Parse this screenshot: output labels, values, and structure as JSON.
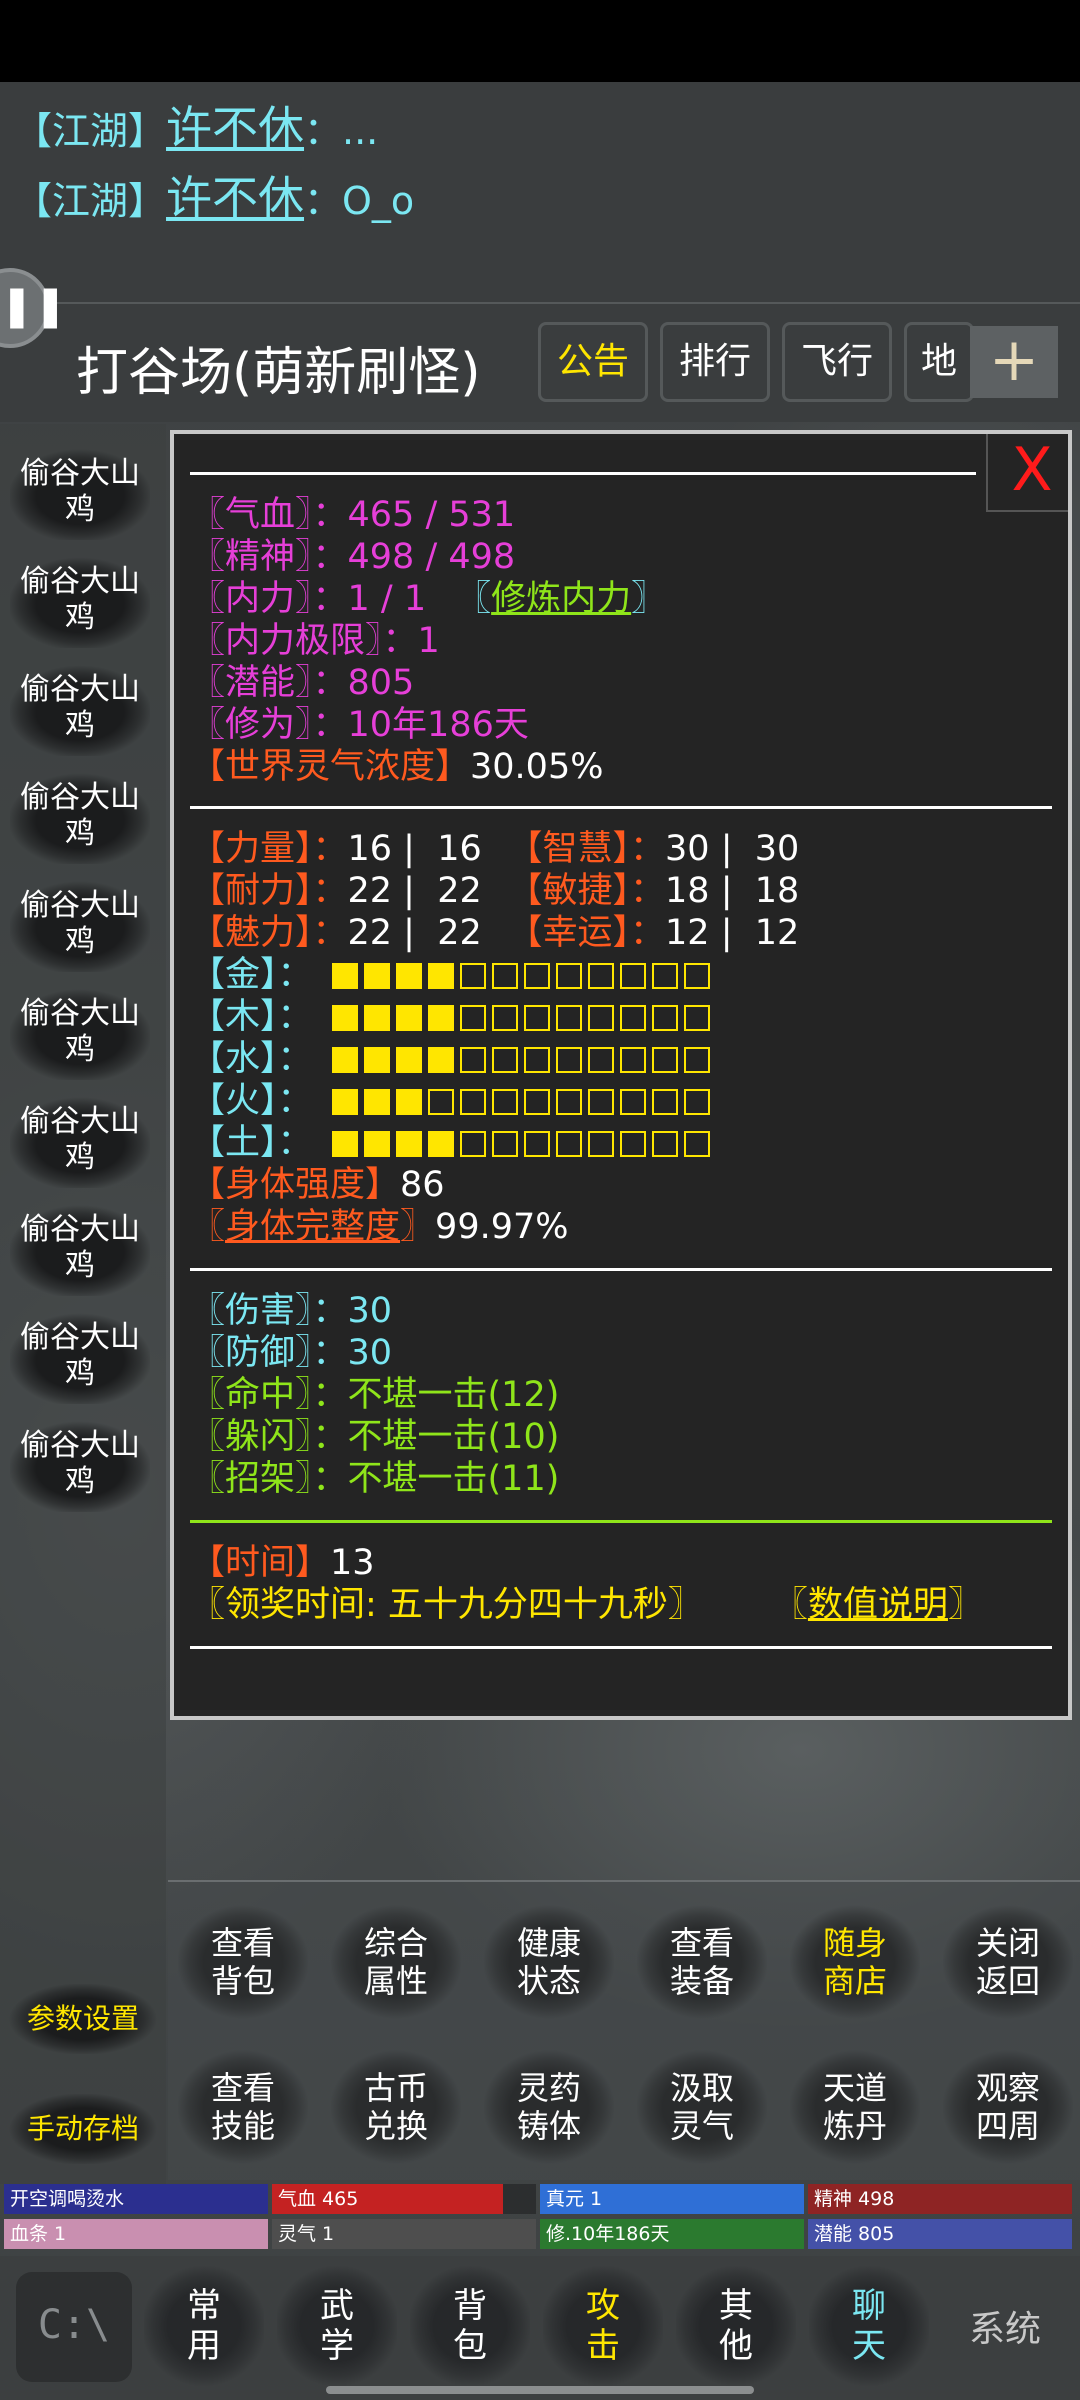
{
  "chat": [
    {
      "tag": "【江湖】",
      "name": "许不休",
      "msg": "：..."
    },
    {
      "tag": "【江湖】",
      "name": "许不休",
      "msg": "：O_o"
    }
  ],
  "side_handle": {
    "icon": "pause-icon",
    "glyph": "❚❚"
  },
  "location": {
    "title": "打谷场(萌新刷怪)"
  },
  "top_buttons": [
    {
      "label": "公告",
      "color": "#ffe600"
    },
    {
      "label": "排行",
      "color": "#ffffff"
    },
    {
      "label": "飞行",
      "color": "#ffffff"
    },
    {
      "label": "地",
      "color": "#ffffff"
    }
  ],
  "plus_label": "+",
  "monsters": [
    "偷谷大山鸡",
    "偷谷大山鸡",
    "偷谷大山鸡",
    "偷谷大山鸡",
    "偷谷大山鸡",
    "偷谷大山鸡",
    "偷谷大山鸡",
    "偷谷大山鸡",
    "偷谷大山鸡",
    "偷谷大山鸡"
  ],
  "panel": {
    "close_label": "X",
    "divider": "————————————————————————————————",
    "vitals": {
      "hp_label": "〖气血〗：",
      "hp_value": "465 / 531",
      "spirit_label": "〖精神〗：",
      "spirit_value": "498 / 498",
      "inner_label": "〖内力〗：",
      "inner_value": "1 / 1",
      "train_open": "〖",
      "train_link": "修炼内力",
      "train_close": "〗",
      "inner_max_label": "〖内力极限〗：",
      "inner_max_value": "1",
      "potential_label": "〖潜能〗：",
      "potential_value": "805",
      "cultivation_label": "〖修为〗：",
      "cultivation_value": "10年186天",
      "world_qi_label": "【世界灵气浓度】",
      "world_qi_value": "30.05%"
    },
    "attributes": [
      {
        "left_label": "【力量】：",
        "left_value": "16 |  16",
        "right_label": "【智慧】：",
        "right_value": "30 |  30"
      },
      {
        "left_label": "【耐力】：",
        "left_value": "22 |  22",
        "right_label": "【敏捷】：",
        "right_value": "18 |  18"
      },
      {
        "left_label": "【魅力】：",
        "left_value": "22 |  22",
        "right_label": "【幸运】：",
        "right_value": "12 |  12"
      }
    ],
    "elements": [
      {
        "label": "【金】：",
        "filled": 4,
        "total": 12
      },
      {
        "label": "【木】：",
        "filled": 4,
        "total": 12
      },
      {
        "label": "【水】：",
        "filled": 4,
        "total": 12
      },
      {
        "label": "【火】：",
        "filled": 3,
        "total": 12
      },
      {
        "label": "【土】：",
        "filled": 4,
        "total": 12
      }
    ],
    "body_strength_label": "【身体强度】",
    "body_strength_value": "86",
    "body_integrity_open": "〖",
    "body_integrity_link": "身体完整度",
    "body_integrity_close": "〗",
    "body_integrity_value": "99.97%",
    "combat": {
      "damage_label": "〖伤害〗：",
      "damage_value": "30",
      "defense_label": "〖防御〗：",
      "defense_value": "30",
      "hit_label": "〖命中〗：",
      "hit_value": "不堪一击(12)",
      "dodge_label": "〖躲闪〗：",
      "dodge_value": "不堪一击(10)",
      "parry_label": "〖招架〗：",
      "parry_value": "不堪一击(11)"
    },
    "time_label": "【时间】",
    "time_value": "13",
    "reward_label": "〖领奖时间: 五十九分四十九秒〗",
    "explain_open": "〖",
    "explain_link": "数值说明",
    "explain_close": "〗"
  },
  "menu": [
    {
      "line1": "查看",
      "line2": "背包",
      "gold": false
    },
    {
      "line1": "综合",
      "line2": "属性",
      "gold": false
    },
    {
      "line1": "健康",
      "line2": "状态",
      "gold": false
    },
    {
      "line1": "查看",
      "line2": "装备",
      "gold": false
    },
    {
      "line1": "随身",
      "line2": "商店",
      "gold": true
    },
    {
      "line1": "关闭",
      "line2": "返回",
      "gold": false
    },
    {
      "line1": "查看",
      "line2": "技能",
      "gold": false
    },
    {
      "line1": "古币",
      "line2": "兑换",
      "gold": false
    },
    {
      "line1": "灵药",
      "line2": "铸体",
      "gold": false
    },
    {
      "line1": "汲取",
      "line2": "灵气",
      "gold": false
    },
    {
      "line1": "天道",
      "line2": "炼丹",
      "gold": false
    },
    {
      "line1": "观察",
      "line2": "四周",
      "gold": false
    }
  ],
  "left_buttons": {
    "settings": "参数设置",
    "save": "手动存档"
  },
  "status_bars": [
    {
      "text": "开空调喝烫水",
      "fill": 1.0,
      "color": "#2b2f8f"
    },
    {
      "text": "气血 465",
      "fill": 0.876,
      "color": "#c42222"
    },
    {
      "text": "真元 1",
      "fill": 1.0,
      "color": "#2f6fd6"
    },
    {
      "text": "精神 498",
      "fill": 1.0,
      "color": "#8e2424"
    },
    {
      "text": "血条 1",
      "fill": 1.0,
      "color": "#c98fb0"
    },
    {
      "text": "灵气 1",
      "fill": 1.0,
      "color": "#4e4e4e"
    },
    {
      "text": "修.10年186天",
      "fill": 1.0,
      "color": "#2b7a2f"
    },
    {
      "text": "潜能 805",
      "fill": 1.0,
      "color": "#4451a8"
    }
  ],
  "bottom_nav": [
    {
      "line1": "常",
      "line2": "用",
      "color": "white"
    },
    {
      "line1": "武",
      "line2": "学",
      "color": "white"
    },
    {
      "line1": "背",
      "line2": "包",
      "color": "white"
    },
    {
      "line1": "攻",
      "line2": "击",
      "color": "yellow"
    },
    {
      "line1": "其",
      "line2": "他",
      "color": "white"
    },
    {
      "line1": "聊",
      "line2": "天",
      "color": "cyan"
    }
  ],
  "console_icon_text": "C:\\",
  "system_icon_text": "系统"
}
